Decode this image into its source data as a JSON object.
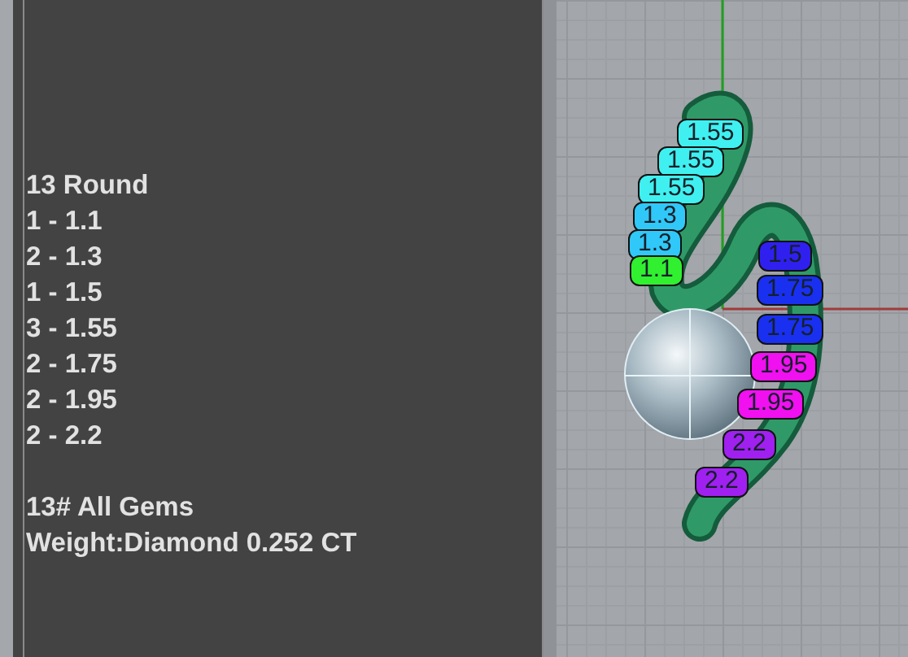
{
  "info_panel": {
    "title": "13 Round",
    "counts": [
      "1 - 1.1",
      "2 - 1.3",
      "1 - 1.5",
      "3 - 1.55",
      "2 - 1.75",
      "2 - 1.95",
      "2 - 2.2"
    ],
    "totals": [
      "13# All Gems",
      "Weight:Diamond 0.252 CT"
    ]
  },
  "viewport": {
    "stone_labels": [
      {
        "text": "1.55",
        "color": "#40f0f0"
      },
      {
        "text": "1.55",
        "color": "#40f0f0"
      },
      {
        "text": "1.55",
        "color": "#40f0f0"
      },
      {
        "text": "1.3",
        "color": "#30c8f8"
      },
      {
        "text": "1.3",
        "color": "#30c8f8"
      },
      {
        "text": "1.1",
        "color": "#30f030"
      },
      {
        "text": "1.5",
        "color": "#3020f0"
      },
      {
        "text": "1.75",
        "color": "#1a30f0"
      },
      {
        "text": "1.75",
        "color": "#1a30f0"
      },
      {
        "text": "1.95",
        "color": "#f010f0"
      },
      {
        "text": "1.95",
        "color": "#f010f0"
      },
      {
        "text": "2.2",
        "color": "#a020f0"
      },
      {
        "text": "2.2",
        "color": "#a020f0"
      }
    ]
  }
}
